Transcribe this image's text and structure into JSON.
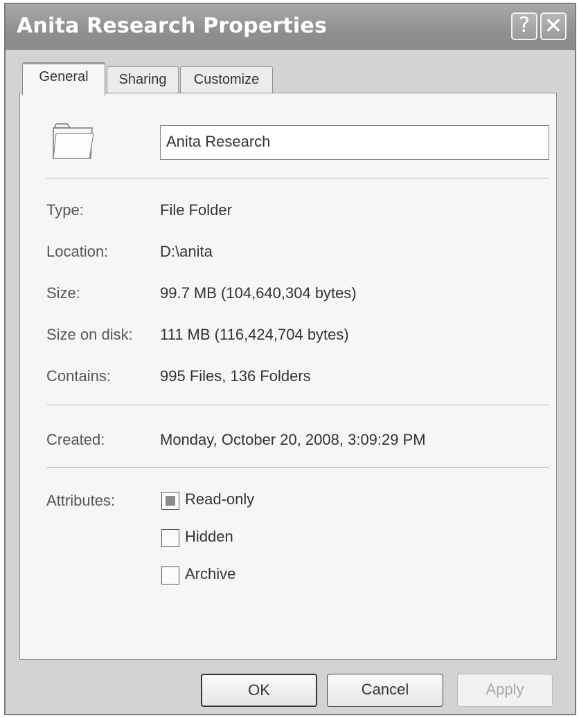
{
  "window": {
    "title": "Anita Research Properties",
    "help_glyph": "?",
    "close_glyph": "✕"
  },
  "tabs": [
    {
      "label": "General",
      "active": true
    },
    {
      "label": "Sharing",
      "active": false
    },
    {
      "label": "Customize",
      "active": false
    }
  ],
  "folder": {
    "icon": "folder-icon",
    "name": "Anita Research"
  },
  "properties": {
    "type_label": "Type:",
    "type_value": "File Folder",
    "location_label": "Location:",
    "location_value": "D:\\anita",
    "size_label": "Size:",
    "size_value": "99.7 MB (104,640,304 bytes)",
    "size_on_disk_label": "Size on disk:",
    "size_on_disk_value": "111 MB (116,424,704 bytes)",
    "contains_label": "Contains:",
    "contains_value": "995 Files, 136 Folders",
    "created_label": "Created:",
    "created_value": "Monday, October 20, 2008, 3:09:29 PM"
  },
  "attributes": {
    "label": "Attributes:",
    "items": [
      {
        "label": "Read-only",
        "state": "mixed"
      },
      {
        "label": "Hidden",
        "state": "unchecked"
      },
      {
        "label": "Archive",
        "state": "unchecked"
      }
    ]
  },
  "buttons": {
    "ok": "OK",
    "cancel": "Cancel",
    "apply": "Apply",
    "apply_enabled": false
  }
}
